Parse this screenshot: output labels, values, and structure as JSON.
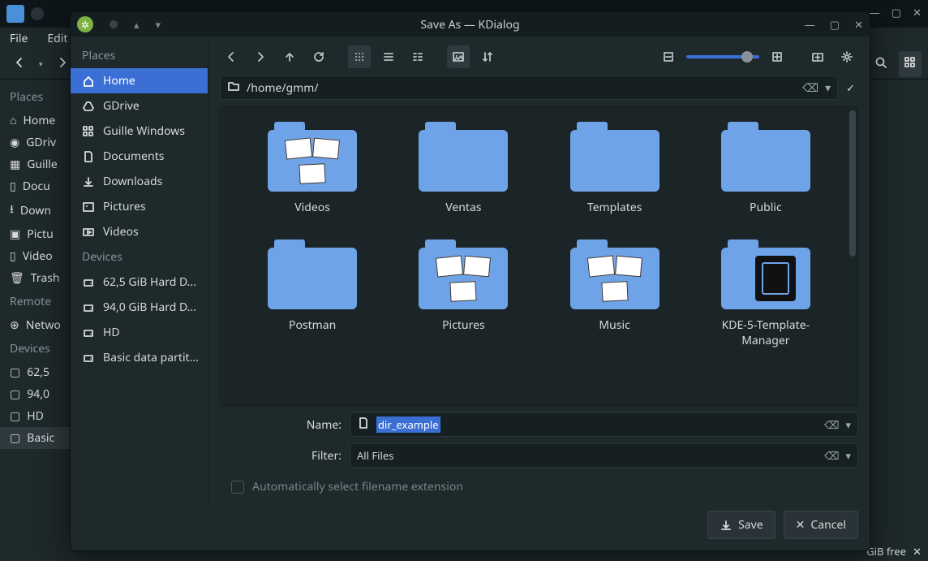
{
  "bg": {
    "menubar": [
      "File",
      "Edit"
    ],
    "sidebar": {
      "places_hdr": "Places",
      "places": [
        "Home",
        "GDriv",
        "Guille",
        "Docu",
        "Down",
        "Pictu",
        "Video",
        "Trash"
      ],
      "remote_hdr": "Remote",
      "remote": [
        "Netwo"
      ],
      "devices_hdr": "Devices",
      "devices": [
        "62,5",
        "94,0",
        "HD",
        "Basic"
      ]
    },
    "status_free": "GiB free"
  },
  "dialog": {
    "title": "Save As — KDialog",
    "sidebar": {
      "places_hdr": "Places",
      "places": [
        {
          "label": "Home",
          "selected": true,
          "icon": "home"
        },
        {
          "label": "GDrive",
          "selected": false,
          "icon": "gdrive"
        },
        {
          "label": "Guille Windows",
          "selected": false,
          "icon": "grid"
        },
        {
          "label": "Documents",
          "selected": false,
          "icon": "doc"
        },
        {
          "label": "Downloads",
          "selected": false,
          "icon": "download"
        },
        {
          "label": "Pictures",
          "selected": false,
          "icon": "image"
        },
        {
          "label": "Videos",
          "selected": false,
          "icon": "video"
        }
      ],
      "devices_hdr": "Devices",
      "devices": [
        {
          "label": "62,5 GiB Hard D..."
        },
        {
          "label": "94,0 GiB Hard D..."
        },
        {
          "label": "HD"
        },
        {
          "label": "Basic data partit..."
        }
      ]
    },
    "path": "/home/gmm/",
    "files": [
      {
        "name": "Videos",
        "thumbs": true
      },
      {
        "name": "Ventas",
        "thumbs": false
      },
      {
        "name": "Templates",
        "thumbs": false
      },
      {
        "name": "Public",
        "thumbs": false
      },
      {
        "name": "Postman",
        "thumbs": false
      },
      {
        "name": "Pictures",
        "thumbs": true
      },
      {
        "name": "Music",
        "thumbs": true
      },
      {
        "name": "KDE-5-Template-Manager",
        "doc": true
      }
    ],
    "name_label": "Name:",
    "name_value": "dir_example",
    "filter_label": "Filter:",
    "filter_value": "All Files",
    "auto_ext": "Automatically select filename extension",
    "save_btn": "Save",
    "cancel_btn": "Cancel"
  }
}
